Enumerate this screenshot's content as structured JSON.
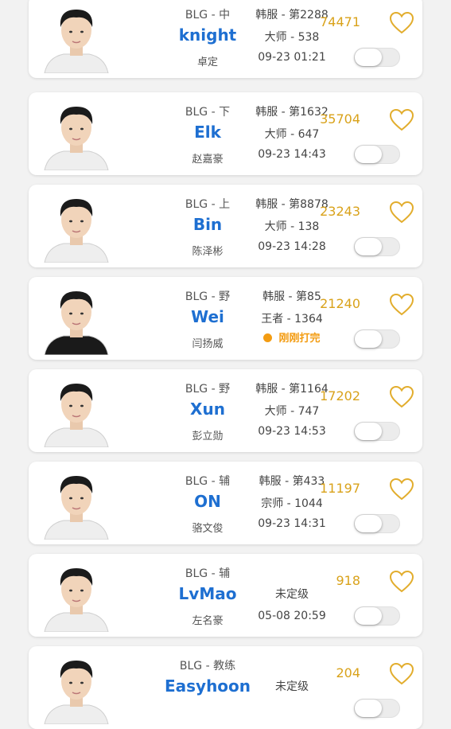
{
  "players": [
    {
      "team_pos": "BLG - 中",
      "nick": "knight",
      "name_cn": "卓定",
      "server": "韩服 - 第2288",
      "tier": "大师 - 538",
      "time": "09-23 01:21",
      "likes": "74471",
      "shirt": "white"
    },
    {
      "team_pos": "BLG - 下",
      "nick": "Elk",
      "name_cn": "赵嘉豪",
      "server": "韩服 - 第1632",
      "tier": "大师 - 647",
      "time": "09-23 14:43",
      "likes": "35704",
      "shirt": "white"
    },
    {
      "team_pos": "BLG - 上",
      "nick": "Bin",
      "name_cn": "陈泽彬",
      "server": "韩服 - 第8878",
      "tier": "大师 - 138",
      "time": "09-23 14:28",
      "likes": "23243",
      "shirt": "white"
    },
    {
      "team_pos": "BLG - 野",
      "nick": "Wei",
      "name_cn": "闫扬威",
      "server": "韩服 - 第85",
      "tier": "王者 - 1364",
      "status": "刚刚打完",
      "likes": "21240",
      "shirt": "black"
    },
    {
      "team_pos": "BLG - 野",
      "nick": "Xun",
      "name_cn": "彭立勋",
      "server": "韩服 - 第1164",
      "tier": "大师 - 747",
      "time": "09-23 14:53",
      "likes": "17202",
      "shirt": "white"
    },
    {
      "team_pos": "BLG - 辅",
      "nick": "ON",
      "name_cn": "骆文俊",
      "server": "韩服 - 第433",
      "tier": "宗师 - 1044",
      "time": "09-23 14:31",
      "likes": "11197",
      "shirt": "white"
    },
    {
      "team_pos": "BLG - 辅",
      "nick": "LvMao",
      "name_cn": "左名豪",
      "tier": "未定级",
      "time": "05-08 20:59",
      "likes": "918",
      "shirt": "white"
    },
    {
      "team_pos": "BLG - 教练",
      "nick": "Easyhoon",
      "name_cn": "",
      "tier": "未定级",
      "likes": "204",
      "shirt": "white"
    }
  ],
  "colors": {
    "accent": "#1e6fd1",
    "likes": "#d9a21a",
    "status": "#f39c12"
  },
  "icons": {
    "like": "heart-outline-icon",
    "toggle": "switch-off"
  }
}
